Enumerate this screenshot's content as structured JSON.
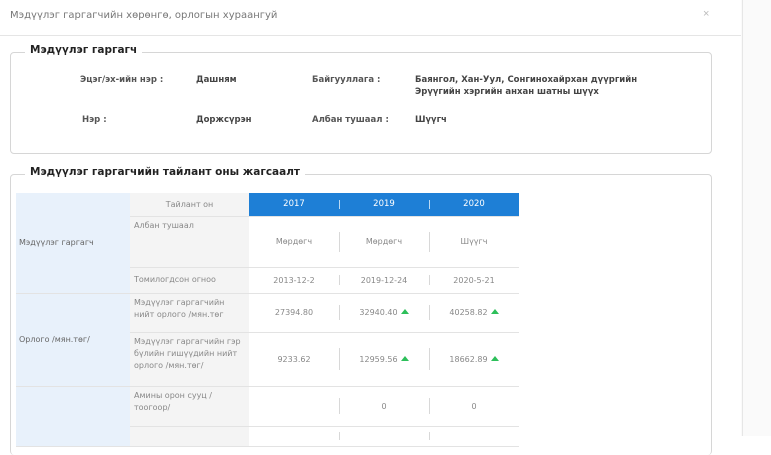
{
  "modal": {
    "title": "Мэдүүлэг гаргагчийн хөрөнгө, орлогын хураангуй",
    "close_icon": "close-icon"
  },
  "declarant": {
    "legend": "Мэдүүлэг гаргагч",
    "surname_label": "Эцэг/эх-ийн нэр :",
    "surname_value": "Дашням",
    "org_label": "Байгууллага :",
    "org_value_line1": "Баянгол, Хан-Уул, Сонгинохайрхан дүүргийн",
    "org_value_line2": "Эрүүгийн хэргийн анхан шатны шүүх",
    "name_label": "Нэр :",
    "name_value": "Доржсүрэн",
    "position_label": "Албан тушаал :",
    "position_value": "Шүүгч"
  },
  "summary": {
    "legend": "Мэдүүлэг гаргагчийн тайлант оны жагсаалт",
    "year_header": "Тайлант он",
    "years": [
      "2017",
      "2019",
      "2020"
    ],
    "groups": {
      "declarant": "Мэдүүлэг гаргагч",
      "income": "Орлого /мян.төг/"
    },
    "rows": {
      "position": {
        "label": "Албан тушаал",
        "values": [
          "Мөрдөгч",
          "Мөрдөгч",
          "Шүүгч"
        ]
      },
      "appointed": {
        "label": "Томилогдсон огноо",
        "values": [
          "2013-12-2",
          "2019-12-24",
          "2020-5-21"
        ]
      },
      "income_total": {
        "label": "Мэдүүлэг гаргагчийн нийт орлого /мян.төг",
        "values": [
          "27394.80",
          "32940.40",
          "40258.82"
        ]
      },
      "family_income": {
        "label": "Мэдүүлэг гаргагчийн гэр бүлийн гишүүдийн нийт орлого /мян.төг/",
        "values": [
          "9233.62",
          "12959.56",
          "18662.89"
        ]
      },
      "housing": {
        "label": "Амины орон сууц /тоогоор/",
        "values": [
          "",
          "0",
          "0"
        ]
      },
      "next": {
        "label": "",
        "values": [
          "",
          "",
          ""
        ]
      }
    },
    "increase_icon": "arrow-up-icon",
    "increase_color": "#2dbf5a",
    "header_color": "#1e7fd6"
  }
}
